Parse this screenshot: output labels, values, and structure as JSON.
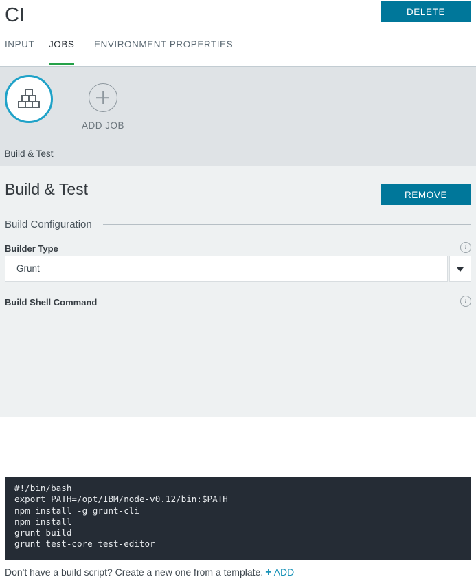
{
  "header": {
    "title": "CI",
    "delete_label": "DELETE"
  },
  "tabs": [
    {
      "label": "INPUT",
      "active": false
    },
    {
      "label": "JOBS",
      "active": true
    },
    {
      "label": "ENVIRONMENT PROPERTIES",
      "active": false
    }
  ],
  "jobs_strip": {
    "job": {
      "label": "Build & Test",
      "icon": "blocks-pyramid-icon",
      "selected": true
    },
    "add_job": {
      "label": "ADD JOB",
      "icon": "plus-circle-icon"
    }
  },
  "job_detail": {
    "title": "Build & Test",
    "remove_label": "REMOVE",
    "config_legend": "Build Configuration",
    "builder_type": {
      "label": "Builder Type",
      "value": "Grunt",
      "info_icon": "info-icon"
    },
    "build_shell_command": {
      "label": "Build Shell Command",
      "info_icon": "info-icon",
      "lines": [
        "#!/bin/bash",
        "export PATH=/opt/IBM/node-v0.12/bin:$PATH",
        "npm install -g grunt-cli",
        "npm install",
        "grunt build",
        "grunt test-core test-editor"
      ]
    },
    "footer": {
      "text": "Don't have a build script? Create a new one from a template.",
      "add_plus": "+",
      "add_label": "ADD"
    }
  },
  "colors": {
    "accent_teal": "#00779a",
    "tab_active_underline": "#24a148",
    "job_circle_ring": "#1fa2c8",
    "link_teal": "#1a93b8",
    "code_background": "#252c35",
    "strip_background": "#dfe3e6",
    "panel_background": "#eef1f2"
  }
}
